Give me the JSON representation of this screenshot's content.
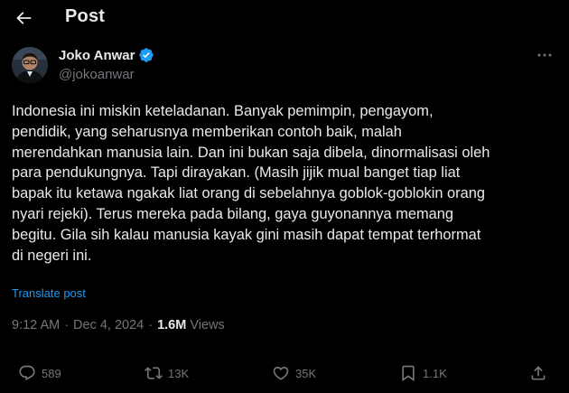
{
  "header": {
    "title": "Post",
    "back_icon": "arrow-left-icon"
  },
  "author": {
    "name": "Joko Anwar",
    "handle": "@jokoanwar",
    "verified": true,
    "verified_color": "#1d9bf0"
  },
  "post": {
    "text": "Indonesia ini miskin keteladanan. Banyak pemimpin, pengayom,\npendidik, yang seharusnya memberikan contoh baik, malah\nmerendahkan manusia lain. Dan ini bukan saja dibela, dinormalisasi oleh\npara pendukungnya. Tapi dirayakan. (Masih jijik mual banget tiap liat\nbapak itu ketawa ngakak liat orang di sebelahnya goblok-goblokin orang\nnyari rejeki). Terus mereka pada bilang, gaya guyonannya memang\nbegitu. Gila sih kalau manusia kayak gini masih dapat tempat terhormat\ndi negeri ini.",
    "translate_label": "Translate post",
    "time": "9:12 AM",
    "date": "Dec 4, 2024",
    "views_count": "1.6M",
    "views_label": "Views"
  },
  "actions": {
    "replies": "589",
    "reposts": "13K",
    "likes": "35K",
    "bookmarks": "1.1K"
  },
  "colors": {
    "background": "#000000",
    "text": "#e7e9ea",
    "muted": "#71767b",
    "accent": "#1d9bf0"
  }
}
